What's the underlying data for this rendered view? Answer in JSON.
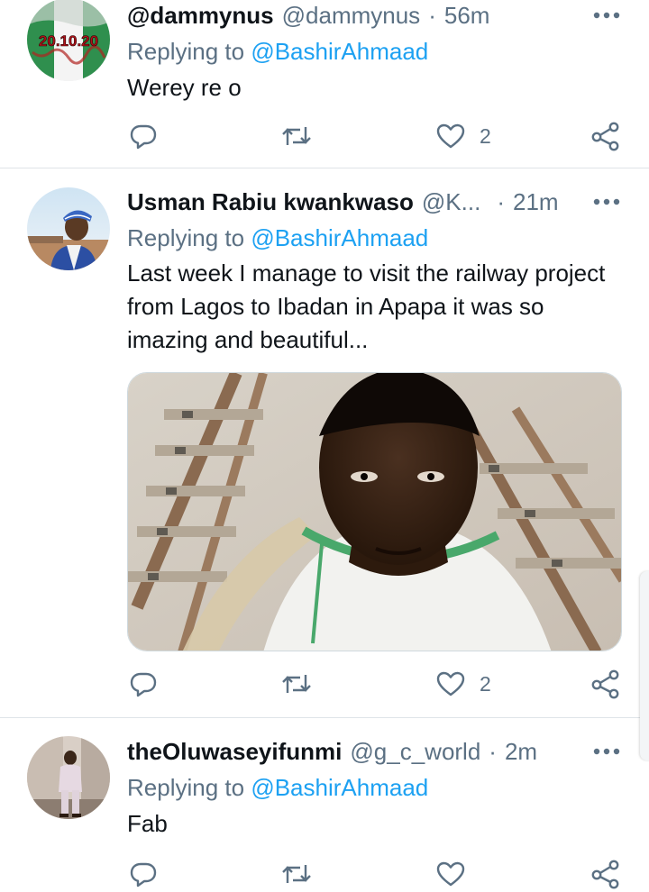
{
  "tweets": [
    {
      "display_name": "",
      "handle": "@dammynus",
      "handle_full": "@dammynus",
      "time": "56m",
      "reply_prefix": "Replying to ",
      "reply_mention": "@BashirAhmaad",
      "text": "Werey re o",
      "avatar_text": "20.10.20",
      "likes": "2"
    },
    {
      "display_name": "Usman Rabiu kwankwaso",
      "handle": "@K",
      "ellipsis": "...",
      "time": "21m",
      "reply_prefix": "Replying to ",
      "reply_mention": "@BashirAhmaad",
      "text": "Last week I manage to visit the railway project from Lagos to Ibadan in Apapa it was so imazing and beautiful...",
      "likes": "2"
    },
    {
      "display_name": "theOluwaseyifunmi",
      "handle": "@g_c_world",
      "time": "2m",
      "reply_prefix": "Replying to ",
      "reply_mention": "@BashirAhmaad",
      "text": "Fab",
      "likes": ""
    }
  ],
  "separator": "·",
  "icons": [
    "reply-icon",
    "retweet-icon",
    "like-icon",
    "share-icon",
    "more-icon"
  ],
  "colors": {
    "text": "#0f1419",
    "muted": "#5b7083",
    "link": "#1da1f2",
    "divider": "#dfe4e8"
  }
}
